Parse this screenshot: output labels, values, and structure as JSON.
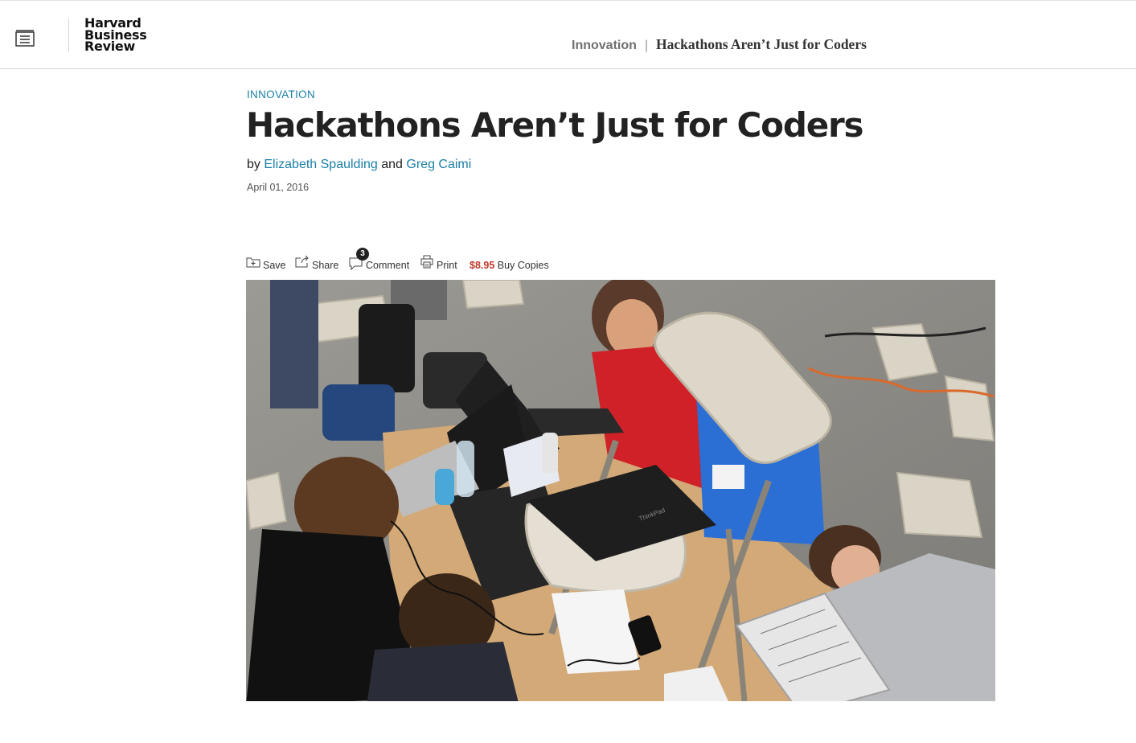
{
  "header": {
    "logo_lines": [
      "Harvard",
      "Business",
      "Review"
    ],
    "breadcrumb_section": "Innovation",
    "breadcrumb_separator": "|",
    "breadcrumb_title": "Hackathons Aren’t Just for Coders"
  },
  "article": {
    "topic": "INNOVATION",
    "title": "Hackathons Aren’t Just for Coders",
    "by_prefix": "by",
    "author1": "Elizabeth Spaulding",
    "conjunction": "and",
    "author2": "Greg Caimi",
    "date": "April 01, 2016"
  },
  "toolbar": {
    "save_label": "Save",
    "share_label": "Share",
    "comment_label": "Comment",
    "comment_count": "3",
    "print_label": "Print",
    "price": "$8.95",
    "buy_label": "Buy Copies"
  },
  "icons": [
    "menu-icon",
    "save-icon",
    "share-icon",
    "comment-icon",
    "print-icon"
  ],
  "colors": {
    "link": "#1a7fa6",
    "price": "#c0392b",
    "text": "#222222"
  }
}
